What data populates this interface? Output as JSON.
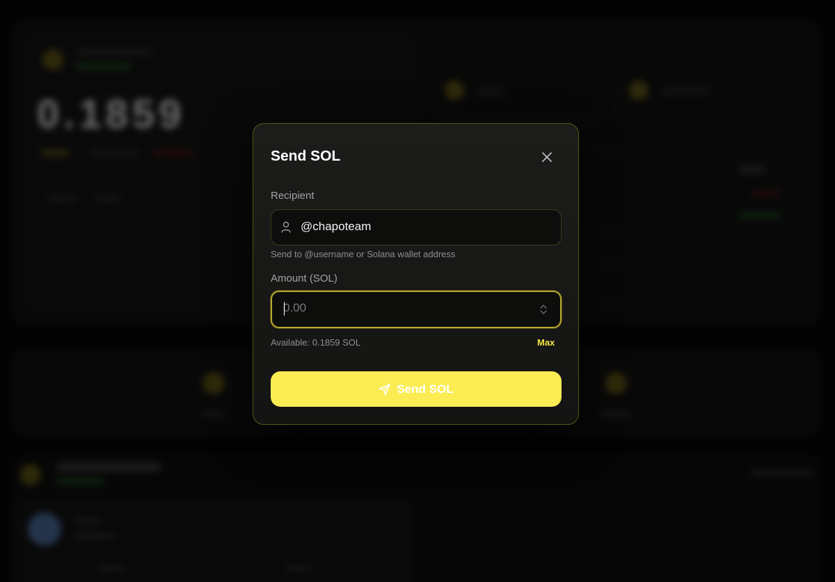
{
  "modal": {
    "title": "Send SOL",
    "recipient_label": "Recipient",
    "recipient_value": "@chapoteam",
    "recipient_hint": "Send to @username or Solana wallet address",
    "amount_label": "Amount (SOL)",
    "amount_placeholder": "0.00",
    "available_text": "Available: 0.1859 SOL",
    "max_label": "Max",
    "send_label": "Send SOL"
  },
  "background": {
    "balance": "0.1859"
  },
  "colors": {
    "accent": "#fcec54",
    "modal_border": "#5b5618",
    "focus_border": "#b8a92c"
  },
  "icons": {
    "close": "close-icon",
    "user": "user-icon",
    "stepper": "stepper-icon",
    "send": "paper-plane-icon"
  }
}
